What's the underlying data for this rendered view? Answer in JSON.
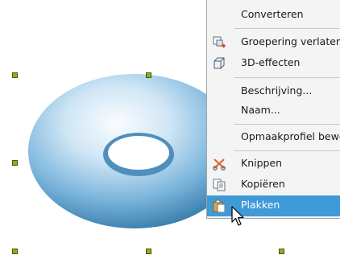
{
  "menu": {
    "items": [
      {
        "label": "Converteren",
        "icon": "none"
      },
      {
        "label": "Groepering verlaten",
        "icon": "ungroup-icon"
      },
      {
        "label": "3D-effecten",
        "icon": "cube-3d-icon"
      },
      {
        "label": "Beschrijving...",
        "icon": "none"
      },
      {
        "label": "Naam...",
        "icon": "none"
      },
      {
        "label": "Opmaakprofiel bewe",
        "icon": "none"
      },
      {
        "label": "Knippen",
        "icon": "scissors-icon"
      },
      {
        "label": "Kopiëren",
        "icon": "copy-icon"
      },
      {
        "label": "Plakken",
        "icon": "paste-icon",
        "highlighted": true
      }
    ]
  },
  "colors": {
    "menu_background": "#f4f4f4",
    "highlight": "#3f9ad8",
    "selection_handle": "#8ab020",
    "torus_light": "#e8f4fb",
    "torus_dark": "#3a7fae"
  }
}
